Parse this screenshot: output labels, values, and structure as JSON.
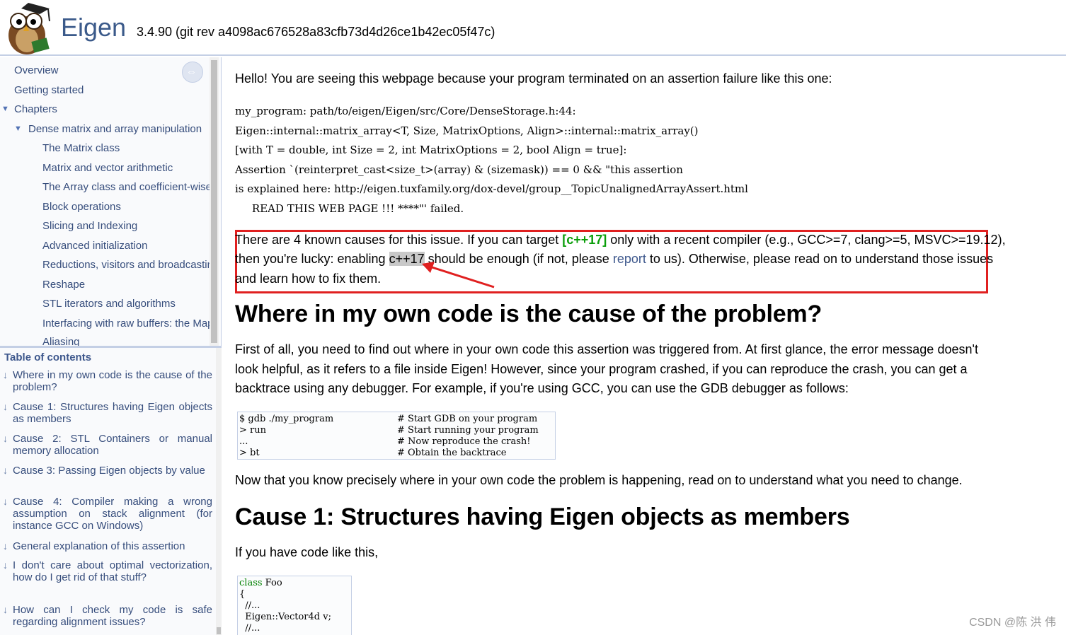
{
  "header": {
    "project_name": "Eigen",
    "version": "3.4.90 (git rev a4098ac676528a83cfb73d4d26ce1b42ec05f47c)"
  },
  "nav": {
    "items": [
      {
        "label": "Overview"
      },
      {
        "label": "Getting started"
      },
      {
        "label": "Chapters"
      },
      {
        "label": "Dense matrix and array manipulation"
      },
      {
        "label": "The Matrix class"
      },
      {
        "label": "Matrix and vector arithmetic"
      },
      {
        "label": "The Array class and coefficient-wise operations"
      },
      {
        "label": "Block operations"
      },
      {
        "label": "Slicing and Indexing"
      },
      {
        "label": "Advanced initialization"
      },
      {
        "label": "Reductions, visitors and broadcasting"
      },
      {
        "label": "Reshape"
      },
      {
        "label": "STL iterators and algorithms"
      },
      {
        "label": "Interfacing with raw buffers: the Map class"
      },
      {
        "label": "Aliasing"
      }
    ]
  },
  "toc": {
    "title": "Table of contents",
    "entries": [
      {
        "label": "Where in my own code is the cause of the problem?"
      },
      {
        "label": "Cause 1: Structures having Eigen objects as members"
      },
      {
        "label": "Cause 2: STL Containers or manual memory allocation"
      },
      {
        "label": "Cause 3: Passing Eigen objects by value"
      },
      {
        "label": "Cause 4: Compiler making a wrong assumption on stack alignment (for instance GCC on Windows)"
      },
      {
        "label": "General explanation of this assertion"
      },
      {
        "label": "I don't care about optimal vectorization, how do I get rid of that stuff?"
      },
      {
        "label": "How can I check my code is safe regarding alignment issues?"
      }
    ]
  },
  "content": {
    "intro": "Hello! You are seeing this webpage because your program terminated on an assertion failure like this one:",
    "assert_lines": [
      "my_program: path/to/eigen/Eigen/src/Core/DenseStorage.h:44:",
      "Eigen::internal::matrix_array<T, Size, MatrixOptions, Align>::internal::matrix_array()",
      "[with T = double, int Size = 2, int MatrixOptions = 2, bool Align = true]:",
      "Assertion `(reinterpret_cast<size_t>(array) & (sizemask)) == 0 && \"this assertion",
      "is explained here: http://eigen.tuxfamily.org/dox-devel/group__TopicUnalignedArrayAssert.html",
      "     READ THIS WEB PAGE !!! ****\"' failed."
    ],
    "causes_p1_a": "There are 4 known causes for this issue. If you can target ",
    "causes_kw": "[c++17]",
    "causes_p1_b": " only with a recent compiler (e.g., GCC>=7, clang>=5, MSVC>=19.12),",
    "causes_p2_a": "then you're lucky: enabling ",
    "causes_hl": "c++17",
    "causes_p2_b": " should be enough (if not, please ",
    "causes_link": "report",
    "causes_p2_c": " to us). Otherwise, please read on to understand those issues",
    "causes_p3": "and learn how to fix them.",
    "h_where": "Where in my own code is the cause of the problem?",
    "where_p1": "First of all, you need to find out where in your own code this assertion was triggered from. At first glance, the error message doesn't",
    "where_p2": "look helpful, as it refers to a file inside Eigen! However, since your program crashed, if you can reproduce the crash, you can get a",
    "where_p3": "backtrace using any debugger. For example, if you're using GCC, you can use the GDB debugger as follows:",
    "gdb": [
      {
        "cmd": "$ gdb ./my_program",
        "comment": "# Start GDB on your program"
      },
      {
        "cmd": "> run",
        "comment": "# Start running your program"
      },
      {
        "cmd": "...",
        "comment": "# Now reproduce the crash!"
      },
      {
        "cmd": "> bt",
        "comment": "# Obtain the backtrace"
      }
    ],
    "now_p": "Now that you know precisely where in your own code the problem is happening, read on to understand what you need to change.",
    "h_cause1": "Cause 1: Structures having Eigen objects as members",
    "code_like": "If you have code like this,",
    "class_kw": "class",
    "class_name": " Foo",
    "code_lines": [
      "{",
      "  //...",
      "  Eigen::Vector4d v;",
      "  //..."
    ]
  },
  "watermark": "CSDN @陈 洪 伟"
}
